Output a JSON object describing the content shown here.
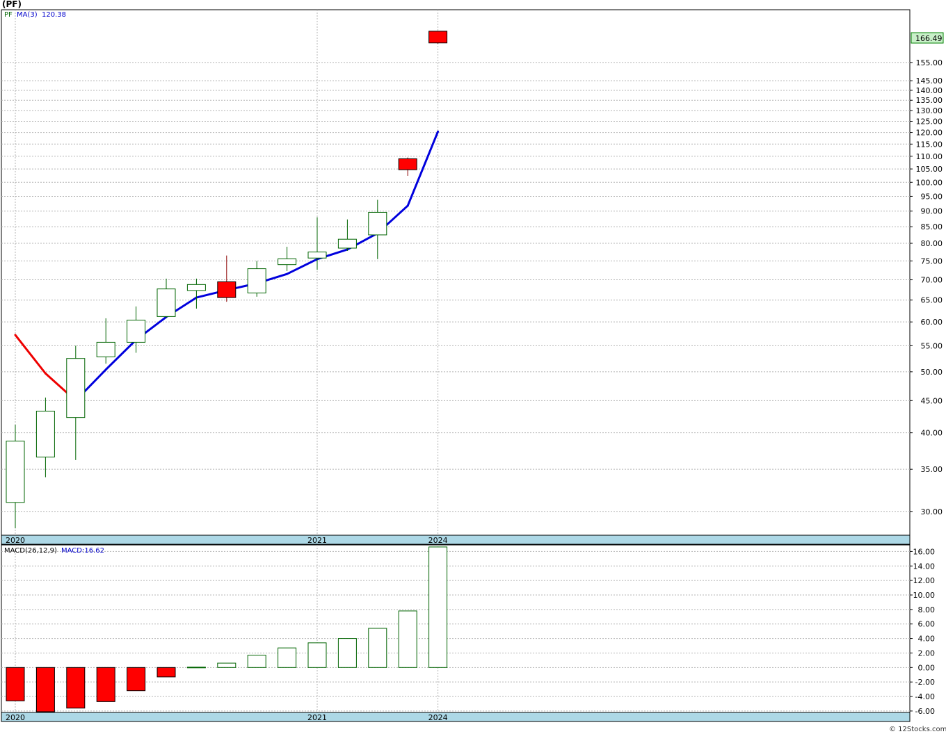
{
  "ticker_title": "(PF)",
  "footer": "© 12Stocks.com",
  "colors": {
    "up_candle_border": "#006400",
    "down_candle_fill": "#ff0000",
    "ma_rising": "#0000dd",
    "ma_falling": "#ee0000",
    "last_price_bg": "#c8f0c8",
    "date_band": "#add8e6",
    "macd_positive_border": "#006400",
    "macd_negative_fill": "#ff0000"
  },
  "chart_data": [
    {
      "type": "candlestick",
      "name": "price",
      "legend": {
        "symbol": "PF",
        "ma_label": "MA(3)",
        "ma_value": "120.38"
      },
      "last_price_label": "166.49",
      "y_scale": "log",
      "ylim": [
        27.5,
        188
      ],
      "y_ticks": [
        30,
        35,
        40,
        45,
        50,
        55,
        60,
        65,
        70,
        75,
        80,
        85,
        90,
        95,
        100,
        105,
        110,
        115,
        120,
        125,
        130,
        135,
        140,
        145,
        155
      ],
      "y_tick_labels": [
        "30.00",
        "35.00",
        "40.00",
        "45.00",
        "50.00",
        "55.00",
        "60.00",
        "65.00",
        "70.00",
        "75.00",
        "80.00",
        "85.00",
        "90.00",
        "95.00",
        "100.00",
        "105.00",
        "110.00",
        "115.00",
        "120.00",
        "125.00",
        "130.00",
        "135.00",
        "140.00",
        "145.00",
        "155.00"
      ],
      "x_labels": [
        {
          "label": "2020",
          "index": 0
        },
        {
          "label": "2021",
          "index": 10
        },
        {
          "label": "2024",
          "index": 14
        }
      ],
      "candles": [
        {
          "o": 31.0,
          "h": 41.2,
          "l": 28.2,
          "c": 38.8
        },
        {
          "o": 36.6,
          "h": 45.5,
          "l": 34.0,
          "c": 43.3
        },
        {
          "o": 42.3,
          "h": 55.0,
          "l": 36.2,
          "c": 52.5
        },
        {
          "o": 52.8,
          "h": 60.8,
          "l": 51.5,
          "c": 55.7
        },
        {
          "o": 55.7,
          "h": 63.5,
          "l": 53.6,
          "c": 60.4
        },
        {
          "o": 61.2,
          "h": 70.3,
          "l": 60.8,
          "c": 67.7
        },
        {
          "o": 67.3,
          "h": 70.3,
          "l": 63.0,
          "c": 68.8
        },
        {
          "o": 69.5,
          "h": 76.5,
          "l": 64.6,
          "c": 65.6
        },
        {
          "o": 66.7,
          "h": 75.0,
          "l": 65.8,
          "c": 72.9
        },
        {
          "o": 74.0,
          "h": 79.0,
          "l": 72.3,
          "c": 75.6
        },
        {
          "o": 75.8,
          "h": 88.0,
          "l": 72.6,
          "c": 77.5
        },
        {
          "o": 78.6,
          "h": 87.3,
          "l": 77.8,
          "c": 81.2
        },
        {
          "o": 82.5,
          "h": 93.8,
          "l": 75.5,
          "c": 89.6
        },
        {
          "o": 109.0,
          "h": 109.5,
          "l": 102.4,
          "c": 104.7
        },
        {
          "o": 173.8,
          "h": 174.0,
          "l": 166.0,
          "c": 166.5
        }
      ],
      "ma_line": [
        {
          "index": 0,
          "value": 57.2
        },
        {
          "index": 1,
          "value": 49.7
        },
        {
          "index": 2,
          "value": 45.0
        },
        {
          "index": 3,
          "value": 50.4
        },
        {
          "index": 4,
          "value": 56.2
        },
        {
          "index": 5,
          "value": 61.1
        },
        {
          "index": 6,
          "value": 65.6
        },
        {
          "index": 7,
          "value": 67.4
        },
        {
          "index": 8,
          "value": 69.1
        },
        {
          "index": 9,
          "value": 71.5
        },
        {
          "index": 10,
          "value": 75.5
        },
        {
          "index": 11,
          "value": 78.2
        },
        {
          "index": 12,
          "value": 83.0
        },
        {
          "index": 13,
          "value": 91.8
        },
        {
          "index": 14,
          "value": 120.38
        }
      ]
    },
    {
      "type": "bar",
      "name": "macd",
      "legend": {
        "label": "MACD(26,12,9)",
        "value_label": "MACD:16.62"
      },
      "ylim": [
        -6.2,
        16.9
      ],
      "y_ticks": [
        -6,
        -4,
        -2,
        0,
        2,
        4,
        6,
        8,
        10,
        12,
        14,
        16
      ],
      "y_tick_labels": [
        "-6.00",
        "-4.00",
        "-2.00",
        "0.00",
        "2.00",
        "4.00",
        "6.00",
        "8.00",
        "10.00",
        "12.00",
        "14.00",
        "16.00"
      ],
      "x_labels": [
        {
          "label": "2020",
          "index": 0
        },
        {
          "label": "2021",
          "index": 10
        },
        {
          "label": "2024",
          "index": 14
        }
      ],
      "values": [
        -4.6,
        -6.1,
        -5.6,
        -4.7,
        -3.2,
        -1.3,
        0.05,
        0.6,
        1.7,
        2.7,
        3.4,
        4.0,
        5.4,
        7.8,
        16.62
      ]
    }
  ]
}
